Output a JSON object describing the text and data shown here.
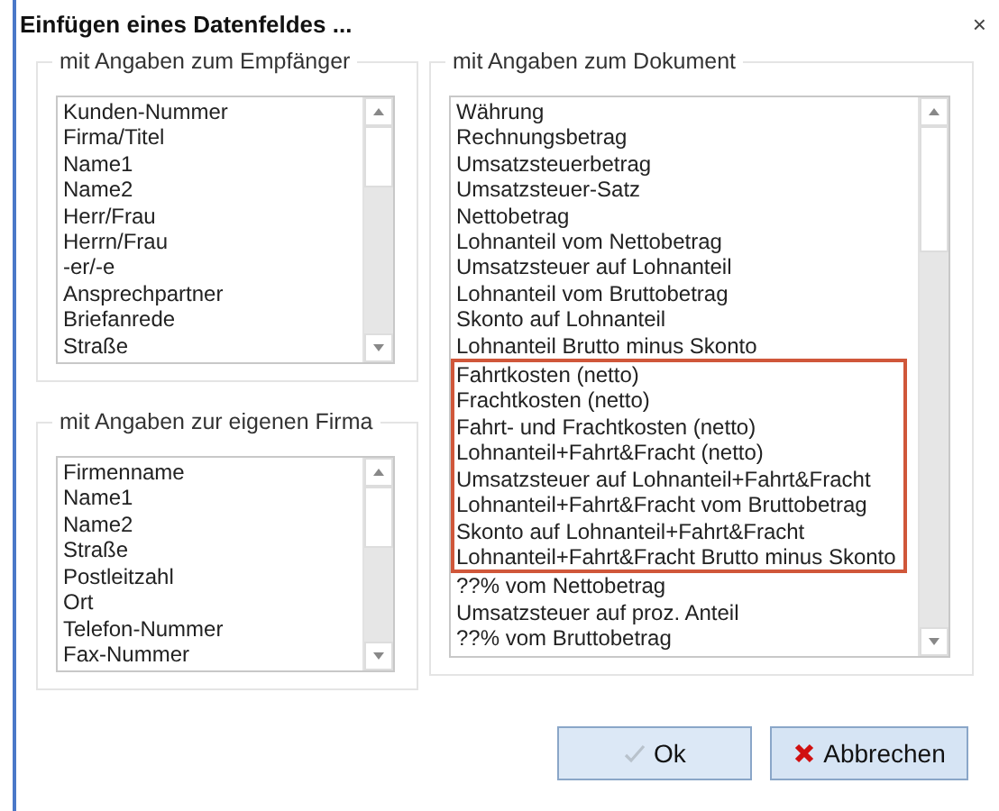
{
  "window": {
    "title": "Einfügen eines Datenfeldes ...",
    "close": "×"
  },
  "groups": [
    {
      "legend": "mit Angaben zum Empfänger",
      "items": [
        {
          "label": "Kunden-Nummer",
          "highlighted": false
        },
        {
          "label": "Firma/Titel",
          "highlighted": false
        },
        {
          "label": "Name1",
          "highlighted": false
        },
        {
          "label": "Name2",
          "highlighted": false
        },
        {
          "label": "Herr/Frau",
          "highlighted": false
        },
        {
          "label": "Herrn/Frau",
          "highlighted": false
        },
        {
          "label": "-er/-e",
          "highlighted": false
        },
        {
          "label": "Ansprechpartner",
          "highlighted": false
        },
        {
          "label": "Briefanrede",
          "highlighted": false
        },
        {
          "label": "Straße",
          "highlighted": false
        }
      ]
    },
    {
      "legend": "mit Angaben zur eigenen Firma",
      "items": [
        {
          "label": "Firmenname",
          "highlighted": false
        },
        {
          "label": "Name1",
          "highlighted": false
        },
        {
          "label": "Name2",
          "highlighted": false
        },
        {
          "label": "Straße",
          "highlighted": false
        },
        {
          "label": "Postleitzahl",
          "highlighted": false
        },
        {
          "label": "Ort",
          "highlighted": false
        },
        {
          "label": "Telefon-Nummer",
          "highlighted": false
        },
        {
          "label": "Fax-Nummer",
          "highlighted": false
        }
      ]
    },
    {
      "legend": "mit Angaben zum Dokument",
      "items": [
        {
          "label": "Währung",
          "highlighted": false
        },
        {
          "label": "Rechnungsbetrag",
          "highlighted": false
        },
        {
          "label": "Umsatzsteuerbetrag",
          "highlighted": false
        },
        {
          "label": "Umsatzsteuer-Satz",
          "highlighted": false
        },
        {
          "label": "Nettobetrag",
          "highlighted": false
        },
        {
          "label": "Lohnanteil vom Nettobetrag",
          "highlighted": false
        },
        {
          "label": "Umsatzsteuer auf Lohnanteil",
          "highlighted": false
        },
        {
          "label": "Lohnanteil vom Bruttobetrag",
          "highlighted": false
        },
        {
          "label": "Skonto auf Lohnanteil",
          "highlighted": false
        },
        {
          "label": "Lohnanteil Brutto minus Skonto",
          "highlighted": false
        },
        {
          "label": "Fahrtkosten (netto)",
          "highlighted": true
        },
        {
          "label": "Frachtkosten (netto)",
          "highlighted": true
        },
        {
          "label": "Fahrt- und Frachtkosten (netto)",
          "highlighted": true
        },
        {
          "label": "Lohnanteil+Fahrt&Fracht (netto)",
          "highlighted": true
        },
        {
          "label": "Umsatzsteuer auf Lohnanteil+Fahrt&Fracht",
          "highlighted": true
        },
        {
          "label": "Lohnanteil+Fahrt&Fracht vom Bruttobetrag",
          "highlighted": true
        },
        {
          "label": "Skonto auf Lohnanteil+Fahrt&Fracht",
          "highlighted": true
        },
        {
          "label": "Lohnanteil+Fahrt&Fracht Brutto minus Skonto",
          "highlighted": true
        },
        {
          "label": "??% vom Nettobetrag",
          "highlighted": false
        },
        {
          "label": "Umsatzsteuer auf proz. Anteil",
          "highlighted": false
        },
        {
          "label": "??% vom Bruttobetrag",
          "highlighted": false
        }
      ]
    }
  ],
  "buttons": [
    {
      "label": "Ok",
      "kind": "ok",
      "disabled": true
    },
    {
      "label": "Abbrechen",
      "kind": "cancel",
      "disabled": false
    }
  ]
}
